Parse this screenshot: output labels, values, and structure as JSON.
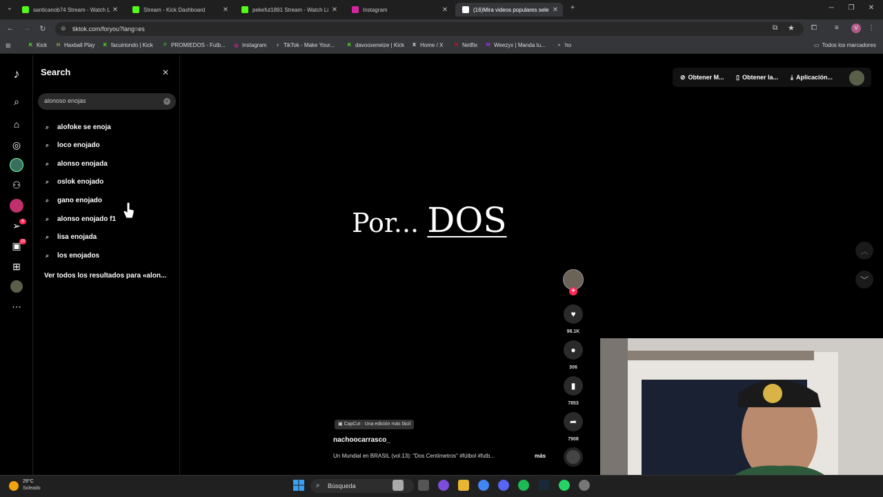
{
  "browser": {
    "tabs": [
      {
        "title": "santicanob74 Stream - Watch L",
        "icon": "kick-icon",
        "color": "#53fc18"
      },
      {
        "title": "Stream - Kick Dashboard",
        "icon": "kick-icon",
        "color": "#53fc18"
      },
      {
        "title": "pekefut1891 Stream - Watch Li",
        "icon": "kick-icon",
        "color": "#53fc18"
      },
      {
        "title": "Instagram",
        "icon": "instagram-icon",
        "color": "#d6249f"
      },
      {
        "title": "(16)Mira videos populares sele",
        "icon": "tiktok-icon",
        "color": "#ffffff",
        "active": true
      }
    ],
    "new_tab": "+",
    "url": "tiktok.com/foryou?lang=es",
    "bookmarks": [
      {
        "label": "Kick",
        "color": "#53fc18",
        "glyph": "K"
      },
      {
        "label": "Haxball Play",
        "color": "#a8a84a",
        "glyph": "H"
      },
      {
        "label": "facuiriondo | Kick",
        "color": "#53fc18",
        "glyph": "K"
      },
      {
        "label": "PROMIEDOS - Futb...",
        "color": "#3c9a3c",
        "glyph": "P"
      },
      {
        "label": "Instagram",
        "color": "#d6249f",
        "glyph": "◎"
      },
      {
        "label": "TikTok - Make Your...",
        "color": "#ffffff",
        "glyph": "♪"
      },
      {
        "label": "davooxeneize | Kick",
        "color": "#53fc18",
        "glyph": "K"
      },
      {
        "label": "Home / X",
        "color": "#ffffff",
        "glyph": "X"
      },
      {
        "label": "Netflix",
        "color": "#e50914",
        "glyph": "N"
      },
      {
        "label": "Weezyx | Manda tu...",
        "color": "#a335ee",
        "glyph": "W"
      },
      {
        "label": "ho",
        "color": "#888888",
        "glyph": "●"
      }
    ],
    "all_bookmarks": "Todos los marcadores"
  },
  "search": {
    "title": "Search",
    "query": "alonoso enojas",
    "suggestions": [
      "alofoke se enoja",
      "loco enojado",
      "alonso enojada",
      "oslok enojado",
      "gano enojado",
      "alonso enojado f1",
      "lisa enojada",
      "los enojados"
    ],
    "view_all": "Ver todos los resultados para «alon..."
  },
  "top_actions": {
    "get_m": "Obtener M...",
    "get_la": "Obtener la...",
    "app": "Aplicación..."
  },
  "video": {
    "overlay_small": "Por...",
    "overlay_big": "DOS",
    "capcut": "CapCut · Una edición más fácil",
    "author": "nachoocarrasco_",
    "caption": "Un Mundial en BRASIL (vol.13): \"Dos Centímetros\" #fútbol #futb...",
    "more": "más",
    "likes": "98.1K",
    "comments": "306",
    "saves": "7853",
    "shares": "7908"
  },
  "taskbar": {
    "temp": "29°C",
    "condition": "Soleado",
    "search_label": "Búsqueda"
  },
  "colors": {
    "tiktok_red": "#fe2c55",
    "kick_green": "#53fc18"
  }
}
